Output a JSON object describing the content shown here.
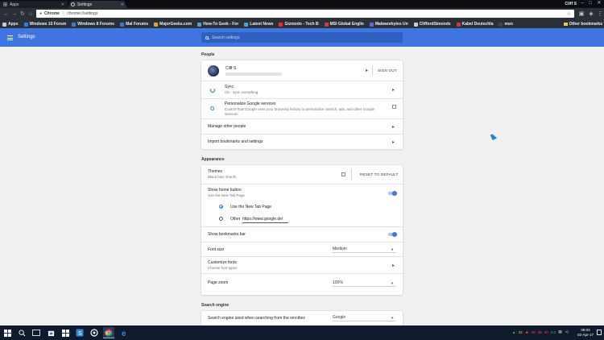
{
  "browser": {
    "tabs": [
      {
        "label": "Apps",
        "active": false
      },
      {
        "label": "Settings",
        "active": true
      }
    ],
    "profile_name": "Cliff S",
    "omnibox": {
      "chip": "Chrome",
      "url": "chrome://settings"
    },
    "bookmarks": [
      {
        "label": "Apps",
        "color": "#c7ccd6"
      },
      {
        "label": "Windows 10 Forum",
        "color": "#3b7bd5"
      },
      {
        "label": "Windows 8 Forums",
        "color": "#3b7bd5"
      },
      {
        "label": "Mal Forums",
        "color": "#3b7bd5"
      },
      {
        "label": "MajorGeeks.com",
        "color": "#e8a22a"
      },
      {
        "label": "How-To Geek - For",
        "color": "#4aa3df"
      },
      {
        "label": "Latest News",
        "color": "#4aa3df"
      },
      {
        "label": "Gizmodo - Tech B",
        "color": "#d33"
      },
      {
        "label": "MSI Global Englis",
        "color": "#d33"
      },
      {
        "label": "Malwarebytes Un",
        "color": "#5b6bd8"
      },
      {
        "label": "CliffordSimonds",
        "color": "#c7ccd6"
      },
      {
        "label": "Kabel Deutschla",
        "color": "#d33"
      },
      {
        "label": "msn",
        "color": "#444"
      }
    ],
    "other_bookmarks": "Other bookmarks"
  },
  "header": {
    "title": "Settings",
    "search_placeholder": "Search settings",
    "accent": "#3f75e0"
  },
  "people": {
    "section_title": "People",
    "account_name": "Cliff S",
    "sign_out": "SIGN OUT",
    "sync_title": "Sync",
    "sync_sub": "On - sync everything",
    "personalize_title": "Personalize Google services",
    "personalize_sub": "Control how Google uses your browsing history to personalize Search, ads, and other Google services",
    "manage": "Manage other people",
    "import": "Import bookmarks and settings"
  },
  "appearance": {
    "section_title": "Appearance",
    "themes_title": "Themes",
    "themes_sub": "Black blue shards",
    "reset": "RESET TO DEFAULT",
    "home_title": "Show home button",
    "home_sub": "Use the New Tab Page",
    "home_enabled": true,
    "radio_ntp": "Use the New Tab Page",
    "radio_other": "Other",
    "other_url": "https://www.google.de/",
    "bookmarks_bar": "Show bookmarks bar",
    "bookmarks_bar_enabled": true,
    "font_size_label": "Font size",
    "font_size_value": "Medium",
    "customize_fonts": "Customize fonts",
    "customize_fonts_sub": "Choose font types",
    "zoom_label": "Page zoom",
    "zoom_value": "100%"
  },
  "search_engine": {
    "section_title": "Search engine",
    "label": "Search engine used when searching from the omnibox",
    "value": "Google"
  },
  "taskbar": {
    "tray_numbers": [
      "32",
      "39",
      "39",
      "30",
      "0.0"
    ],
    "time": "09:03",
    "date": "02-Apr-17"
  }
}
